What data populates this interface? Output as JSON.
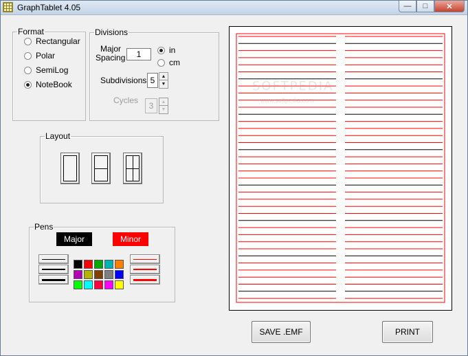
{
  "window": {
    "title": "GraphTablet 4.05"
  },
  "format": {
    "legend": "Format",
    "options": [
      {
        "label": "Rectangular",
        "checked": false
      },
      {
        "label": "Polar",
        "checked": false
      },
      {
        "label": "SemiLog",
        "checked": false
      },
      {
        "label": "NoteBook",
        "checked": true
      }
    ]
  },
  "divisions": {
    "legend": "Divisions",
    "major_label_1": "Major",
    "major_label_2": "Spacing",
    "major_value": "1",
    "unit_in": "in",
    "unit_cm": "cm",
    "unit_selected": "in",
    "subdivisions_label": "Subdivisions",
    "subdivisions_value": "5",
    "cycles_label": "Cycles",
    "cycles_value": "3"
  },
  "layout": {
    "legend": "Layout"
  },
  "pens": {
    "legend": "Pens",
    "major_label": "Major",
    "minor_label": "Minor",
    "major_color": "#000000",
    "minor_color": "#ff0000",
    "palette": [
      "#000000",
      "#ff0000",
      "#00aa00",
      "#00b4b4",
      "#ff8000",
      "#b400b4",
      "#b4b400",
      "#804000",
      "#808080",
      "#0000ff",
      "#00ff00",
      "#00ffff",
      "#ff0040",
      "#ff00ff",
      "#ffff00"
    ]
  },
  "buttons": {
    "save": "SAVE .EMF",
    "print": "PRINT"
  },
  "watermark": {
    "text": "SOFTPEDIA",
    "sub": "www.softpedia.com"
  }
}
